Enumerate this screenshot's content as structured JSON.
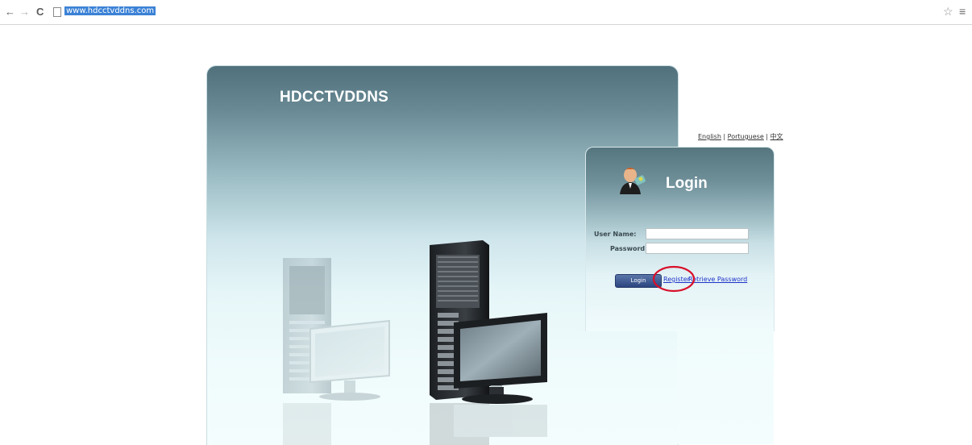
{
  "browser": {
    "url": "www.hdcctvddns.com"
  },
  "banner": {
    "title": "HDCCTVDDNS"
  },
  "languages": {
    "english": "English",
    "portuguese": "Portuguese",
    "chinese": "中文",
    "separator": " | "
  },
  "login": {
    "title": "Login",
    "username_label": "User Name:",
    "password_label": "Password:",
    "username_value": "",
    "password_value": "",
    "login_button": "Login",
    "register_link": "Register",
    "retrieve_link": "Retrieve Password"
  },
  "colors": {
    "accent_blue": "#2b4680",
    "link_blue": "#1d32c8",
    "highlight_red": "#d8102a",
    "address_highlight": "#3b82d6"
  }
}
